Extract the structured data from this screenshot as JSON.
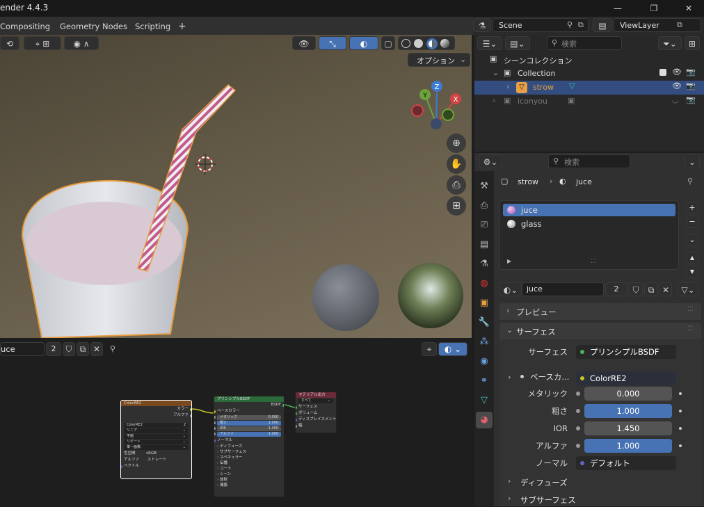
{
  "app": {
    "title": "ender 4.4.3"
  },
  "window": {
    "minimize": "—",
    "maximize": "❐",
    "close": "✕"
  },
  "workspace_tabs": [
    "Compositing",
    "Geometry Nodes",
    "Scripting"
  ],
  "add_tab": "+",
  "scene": {
    "label": "Scene",
    "viewlayer": "ViewLayer"
  },
  "viewport": {
    "options_label": "オプション",
    "gizmo": {
      "z": "Z",
      "y": "Y",
      "x": "X"
    }
  },
  "node_editor": {
    "material_name": "uce",
    "user_count": "2",
    "color_node": {
      "title": "ColorRE2",
      "out_color": "カラー",
      "out_alpha": "アルファ",
      "image_name": "ColorRE2",
      "image_count": "2",
      "interp": "リニア",
      "proj": "平面",
      "ext": "リピート",
      "source": "単一画像",
      "colorspace_label": "色空間",
      "colorspace": "sRGB",
      "alpha_label": "アルファ",
      "alpha": "ストレート",
      "vector": "ベクトル"
    },
    "bsdf_node": {
      "title": "プリンシプルBSDF",
      "out": "BSDF",
      "base_color": "ベースカラー",
      "fields": [
        {
          "label": "メタリック",
          "value": "0.000",
          "blue": false
        },
        {
          "label": "粗さ",
          "value": "1.000",
          "blue": true
        },
        {
          "label": "IOR",
          "value": "1.450",
          "blue": false
        },
        {
          "label": "アルファ",
          "value": "1.000",
          "blue": true
        }
      ],
      "normal": "ノーマル",
      "subpanels": [
        "ディフューズ",
        "サブサーフェス",
        "スペキュラー",
        "伝播",
        "コート",
        "シーン",
        "放射",
        "薄膜"
      ]
    },
    "output_node": {
      "title": "マテリアル出力",
      "target": "すべて",
      "inputs": [
        "サーフェス",
        "ボリューム",
        "ディスプレイスメント",
        "幅"
      ]
    }
  },
  "outliner": {
    "search_placeholder": "検索",
    "scene_collection": "シーンコレクション",
    "items": [
      {
        "name": "Collection",
        "indent": 1
      },
      {
        "name": "strow",
        "indent": 2,
        "selected": true
      },
      {
        "name": "iconyou",
        "indent": 1
      }
    ]
  },
  "properties": {
    "search_placeholder": "検索",
    "breadcrumb": {
      "object": "strow",
      "material": "juce"
    },
    "slots": [
      {
        "name": "juce",
        "selected": true
      },
      {
        "name": "glass",
        "selected": false
      }
    ],
    "material": {
      "name": "juce",
      "users": "2"
    },
    "panels": {
      "preview": "プレビュー",
      "surface": "サーフェス"
    },
    "surface": {
      "label": "サーフェス",
      "shader": "プリンシプルBSDF",
      "base_color_label": "ベースカ...",
      "base_color_value": "ColorRE2"
    },
    "fields": [
      {
        "label": "メタリック",
        "value": "0.000",
        "blue": false,
        "fill": 0
      },
      {
        "label": "粗さ",
        "value": "1.000",
        "blue": true,
        "fill": 1
      },
      {
        "label": "IOR",
        "value": "1.450",
        "blue": false,
        "fill": 0
      },
      {
        "label": "アルファ",
        "value": "1.000",
        "blue": true,
        "fill": 1
      }
    ],
    "normal": {
      "label": "ノーマル",
      "value": "デフォルト"
    },
    "subpanels": [
      "ディフューズ",
      "サブサーフェス"
    ]
  }
}
